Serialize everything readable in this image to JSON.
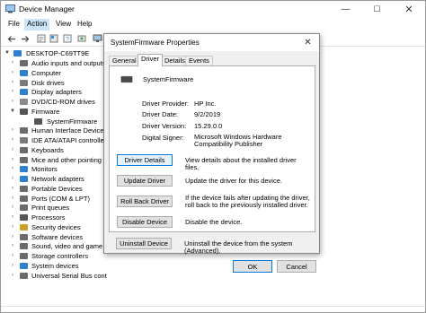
{
  "window": {
    "title": "Device Manager",
    "controls": {
      "minimize": "—",
      "maximize": "☐",
      "close": "✕"
    }
  },
  "menu": [
    "File",
    "Action",
    "View",
    "Help"
  ],
  "toolbar_icons": [
    "back-arrow-icon",
    "forward-arrow-icon",
    "properties-icon",
    "help-icon",
    "update-driver-icon",
    "monitor-icon"
  ],
  "tree": {
    "root": "DESKTOP-C69TT9E",
    "items": [
      {
        "label": "Audio inputs and outputs",
        "icon": "audio-icon",
        "color": "#6b6b6b"
      },
      {
        "label": "Computer",
        "icon": "computer-icon",
        "color": "#2f7fd1"
      },
      {
        "label": "Disk drives",
        "icon": "disk-icon",
        "color": "#7a7a7a"
      },
      {
        "label": "Display adapters",
        "icon": "display-icon",
        "color": "#2f7fd1"
      },
      {
        "label": "DVD/CD-ROM drives",
        "icon": "dvd-icon",
        "color": "#8a8a8a"
      },
      {
        "label": "Firmware",
        "icon": "firmware-icon",
        "color": "#555555"
      },
      {
        "label": "SystemFirmware",
        "icon": "chip-icon",
        "color": "#555555"
      },
      {
        "label": "Human Interface Device",
        "icon": "hid-icon",
        "color": "#6b6b6b"
      },
      {
        "label": "IDE ATA/ATAPI controller",
        "icon": "ide-icon",
        "color": "#7a7a7a"
      },
      {
        "label": "Keyboards",
        "icon": "keyboard-icon",
        "color": "#6b6b6b"
      },
      {
        "label": "Mice and other pointing",
        "icon": "mouse-icon",
        "color": "#6b6b6b"
      },
      {
        "label": "Monitors",
        "icon": "monitor-icon",
        "color": "#2f7fd1"
      },
      {
        "label": "Network adapters",
        "icon": "network-icon",
        "color": "#2f7fd1"
      },
      {
        "label": "Portable Devices",
        "icon": "portable-icon",
        "color": "#6b6b6b"
      },
      {
        "label": "Ports (COM & LPT)",
        "icon": "port-icon",
        "color": "#6b6b6b"
      },
      {
        "label": "Print queues",
        "icon": "printer-icon",
        "color": "#6b6b6b"
      },
      {
        "label": "Processors",
        "icon": "processor-icon",
        "color": "#555555"
      },
      {
        "label": "Security devices",
        "icon": "security-icon",
        "color": "#c9a227"
      },
      {
        "label": "Software devices",
        "icon": "software-icon",
        "color": "#6b6b6b"
      },
      {
        "label": "Sound, video and game",
        "icon": "sound-icon",
        "color": "#6b6b6b"
      },
      {
        "label": "Storage controllers",
        "icon": "storage-icon",
        "color": "#6b6b6b"
      },
      {
        "label": "System devices",
        "icon": "system-icon",
        "color": "#2f7fd1"
      },
      {
        "label": "Universal Serial Bus cont",
        "icon": "usb-icon",
        "color": "#6b6b6b"
      }
    ]
  },
  "dialog": {
    "title": "SystemFirmware Properties",
    "close": "✕",
    "tabs": [
      "General",
      "Driver",
      "Details",
      "Events"
    ],
    "active_tab": "Driver",
    "device_name": "SystemFirmware",
    "props": [
      {
        "label": "Driver Provider:",
        "value": "HP Inc."
      },
      {
        "label": "Driver Date:",
        "value": "9/2/2019"
      },
      {
        "label": "Driver Version:",
        "value": "15.29.0.0"
      },
      {
        "label": "Digital Signer:",
        "value": "Microsoft Windows Hardware Compatibility Publisher"
      }
    ],
    "actions": [
      {
        "button": "Driver Details",
        "desc": "View details about the installed driver files."
      },
      {
        "button": "Update Driver",
        "desc": "Update the driver for this device."
      },
      {
        "button": "Roll Back Driver",
        "desc": "If the device fails after updating the driver, roll back to the previously installed driver."
      },
      {
        "button": "Disable Device",
        "desc": "Disable the device."
      },
      {
        "button": "Uninstall Device",
        "desc": "Uninstall the device from the system (Advanced)."
      }
    ],
    "ok": "OK",
    "cancel": "Cancel"
  },
  "colors": {
    "accent": "#0078d7",
    "menu_highlight": "#cce4f7",
    "dialog_bg": "#f0f0f0"
  }
}
